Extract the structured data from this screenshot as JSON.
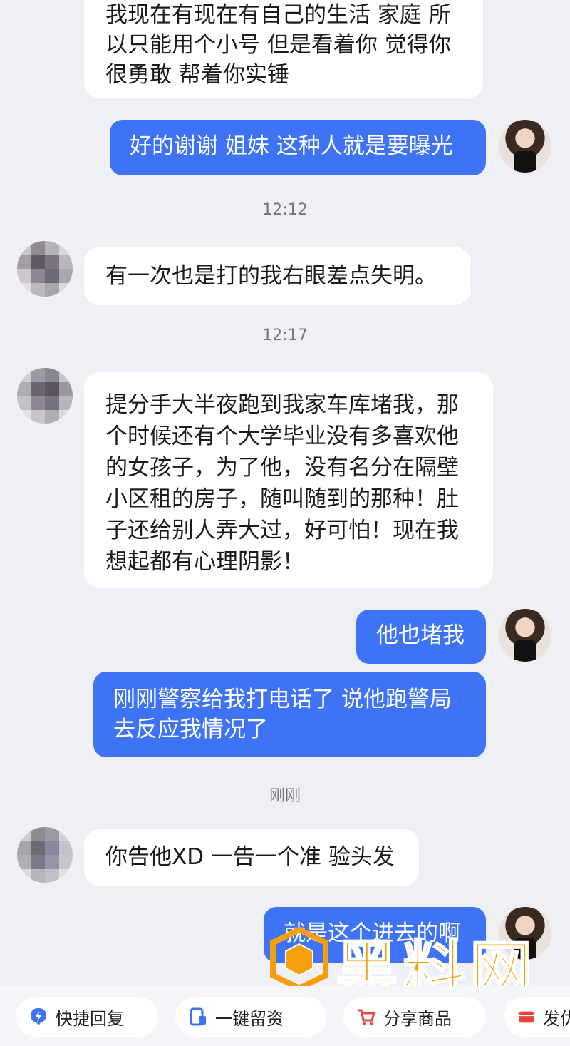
{
  "messages": {
    "m1": {
      "lines": [
        "我现在有现在有自己的生活 家庭 所",
        "以只能用个小号 但是看着你 觉得你",
        "很勇敢 帮着你实锤"
      ]
    },
    "m2": {
      "text": "好的谢谢 姐妹 这种人就是要曝光"
    },
    "t1": "12:12",
    "m3": {
      "text": "有一次也是打的我右眼差点失明。"
    },
    "t2": "12:17",
    "m4": {
      "lines": [
        "提分手大半夜跑到我家车库堵我，那",
        "个时候还有个大学毕业没有多喜欢他",
        "的女孩子，为了他，没有名分在隔壁",
        "小区租的房子，随叫随到的那种！肚",
        "子还给别人弄大过，好可怕！现在我",
        "想起都有心理阴影！"
      ]
    },
    "m5": {
      "text": "他也堵我"
    },
    "m6": {
      "lines": [
        "刚刚警察给我打电话了 说他跑警局",
        "去反应我情况了"
      ]
    },
    "t3": "刚刚",
    "m7": {
      "text": "你告他XD 一告一个准 验头发"
    },
    "m8": {
      "text": "就是这个进去的啊"
    }
  },
  "bottom_bar": {
    "quick_reply": "快捷回复",
    "one_click": "一键留资",
    "share": "分享商品",
    "send": "发优"
  },
  "watermark": {
    "title": "黑料网",
    "url": "https://hlwe4.com"
  },
  "colors": {
    "background": "#eef0f5",
    "outgoing_bubble": "#3f73f6",
    "incoming_bubble": "#ffffff",
    "watermark": "#f59f0c"
  }
}
